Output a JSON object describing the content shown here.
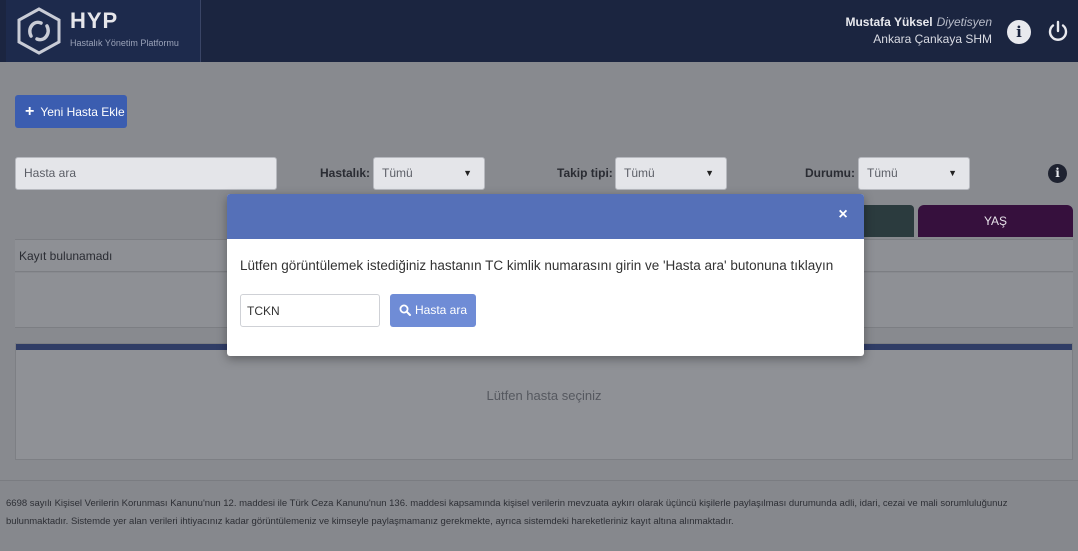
{
  "header": {
    "logo_title": "HYP",
    "logo_subtitle": "Hastalık Yönetim Platformu",
    "user_name": "Mustafa Yüksel",
    "user_role": "Diyetisyen",
    "user_unit": "Ankara Çankaya SHM",
    "info_icon": "info-icon",
    "power_icon": "power-icon"
  },
  "toolbar": {
    "add_patient_label": "Yeni Hasta Ekle"
  },
  "filters": {
    "search_placeholder": "Hasta ara",
    "disease_label": "Hastalık:",
    "disease_value": "Tümü",
    "tracking_label": "Takip tipi:",
    "tracking_value": "Tümü",
    "status_label": "Durumu:",
    "status_value": "Tümü"
  },
  "table": {
    "age_header": "YAŞ",
    "empty_message": "Kayıt bulunamadı"
  },
  "detail_panel": {
    "placeholder": "Lütfen hasta seçiniz"
  },
  "modal": {
    "close_symbol": "×",
    "message": "Lütfen görüntülemek istediğiniz hastanın TC kimlik numarasını girin ve 'Hasta ara' butonuna tıklayın",
    "tckn_placeholder": "TCKN",
    "search_button_label": "Hasta ara"
  },
  "footer": {
    "notice": "6698 sayılı Kişisel Verilerin Korunması Kanunu'nun 12. maddesi ile Türk Ceza Kanunu'nun 136. maddesi kapsamında kişisel verilerin mevzuata aykırı olarak üçüncü kişilerle paylaşılması durumunda adli, idari, cezai ve mali sorumluluğunuz bulunmaktadır. Sistemde yer alan verileri ihtiyacınız kadar görüntülemeniz ve kimseyle paylaşmamanız gerekmekte, ayrıca sistemdeki hareketleriniz kayıt altına alınmaktadır."
  },
  "colors": {
    "header_bg": "#1b2540",
    "modal_header": "#5570b8",
    "primary_button": "#6f8cd6",
    "age_header": "#36103d"
  }
}
